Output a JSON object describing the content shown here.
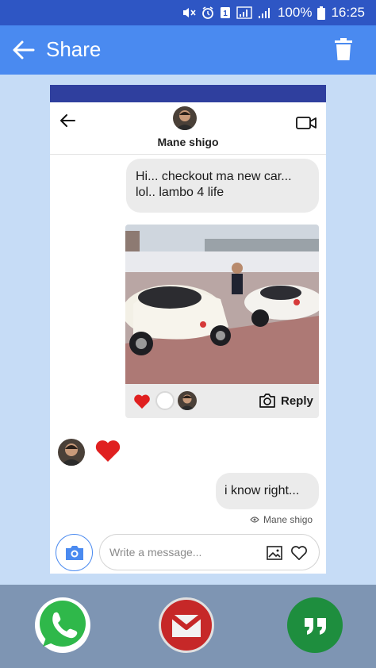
{
  "status": {
    "percent": "100%",
    "time": "16:25",
    "sim_badge": "1"
  },
  "appbar": {
    "title": "Share",
    "back_icon": "arrow-left-icon",
    "delete_icon": "trash-icon"
  },
  "chat": {
    "contact_name": "Mane shigo",
    "messages": [
      {
        "from": "me",
        "text": "Hi... checkout ma new car... lol.. lambo 4 life"
      },
      {
        "from": "me",
        "type": "photo",
        "reply_label": "Reply"
      },
      {
        "from": "them",
        "type": "reaction",
        "icon": "heart-icon"
      },
      {
        "from": "me",
        "text": "i know right..."
      }
    ],
    "seen_by": "Mane shigo",
    "composer": {
      "placeholder": "Write a message..."
    }
  },
  "share_targets": [
    {
      "name": "whatsapp",
      "icon": "whatsapp-icon"
    },
    {
      "name": "gmail",
      "icon": "gmail-icon"
    },
    {
      "name": "hangouts",
      "icon": "hangouts-icon"
    }
  ],
  "colors": {
    "status_bar": "#2e56c4",
    "app_bar": "#4a8af0",
    "heart": "#e02020",
    "bottom_bar": "#7e95b3"
  }
}
